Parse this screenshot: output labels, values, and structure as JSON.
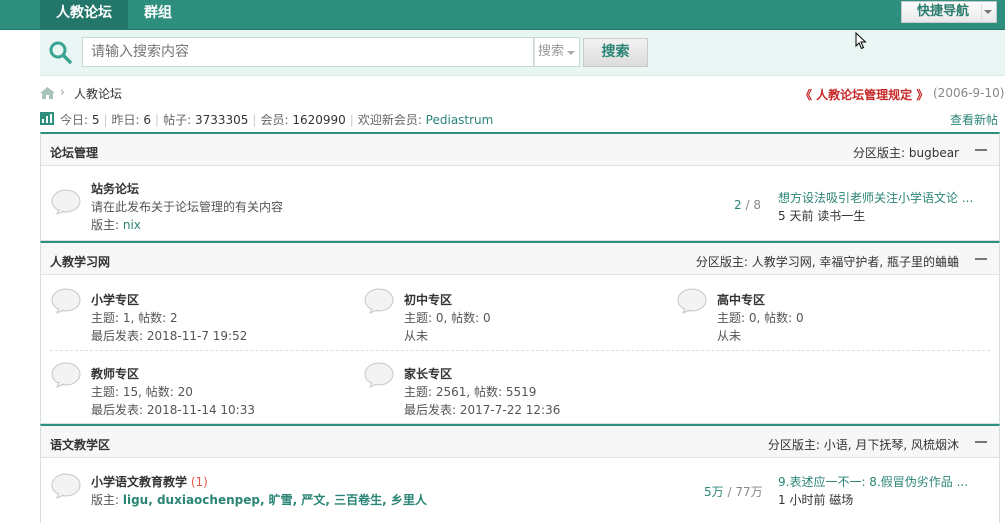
{
  "nav": {
    "tabs": [
      {
        "label": "人教论坛",
        "active": true
      },
      {
        "label": "群组",
        "active": false
      }
    ],
    "quick_nav_label": "快捷导航"
  },
  "search": {
    "placeholder": "请输入搜索内容",
    "type_label": "搜索",
    "button_label": "搜索"
  },
  "breadcrumb": {
    "items": [
      "人教论坛"
    ]
  },
  "announcement": {
    "title": "《 人教论坛管理规定 》",
    "date": "(2006-9-10)"
  },
  "stats": {
    "today_label": "今日: ",
    "today": "5",
    "yesterday_label": "昨日: ",
    "yesterday": "6",
    "posts_label": "帖子: ",
    "posts": "3733305",
    "members_label": "会员: ",
    "members": "1620990",
    "newest_label": "欢迎新会员: ",
    "newest_member": "Pediastrum",
    "view_new": "查看新帖"
  },
  "sections": [
    {
      "title": "论坛管理",
      "moderators": "分区版主: bugbear",
      "forums": [
        {
          "name": "站务论坛",
          "desc": "请在此发布关于论坛管理的有关内容",
          "mod_label": "版主: ",
          "mod": "nix",
          "threads": "2",
          "posts": " / 8",
          "last_title": "想方设法吸引老师关注小学语文论 ...",
          "last_meta": "5 天前 读书一生"
        }
      ]
    },
    {
      "title": "人教学习网",
      "moderators": "分区版主: 人教学习网, 幸福守护者, 瓶子里的蛐蛐",
      "forums": [
        {
          "name": "小学专区",
          "stats": "主题: 1, 帖数: 2",
          "last": "最后发表: 2018-11-7 19:52"
        },
        {
          "name": "初中专区",
          "stats": "主题: 0, 帖数: 0",
          "last": "从未"
        },
        {
          "name": "高中专区",
          "stats": "主题: 0, 帖数: 0",
          "last": "从未"
        },
        {
          "name": "教师专区",
          "stats": "主题: 15, 帖数: 20",
          "last": "最后发表: 2018-11-14 10:33"
        },
        {
          "name": "家长专区",
          "stats": "主题: 2561, 帖数: 5519",
          "last": "最后发表: 2017-7-22 12:36"
        }
      ]
    },
    {
      "title": "语文教学区",
      "moderators": "分区版主: 小语, 月下抚琴, 风梳烟沐",
      "forums": [
        {
          "name": "小学语文教育教学",
          "new_count": " (1)",
          "mod_label": "版主: ",
          "mods": "ligu, duxiaochenpep, 旷雪, 严文, 三百卷生, 乡里人",
          "threads": "5万",
          "posts": " / 77万",
          "last_title": "9.表述应一不一: 8.假冒伪劣作品 ...",
          "last_meta": "1 小时前 磁场"
        }
      ]
    }
  ],
  "colors": {
    "brand": "#2e8f7f",
    "link": "#2b8576",
    "announcement": "#c62a2a",
    "new_count": "#e05a4b"
  }
}
